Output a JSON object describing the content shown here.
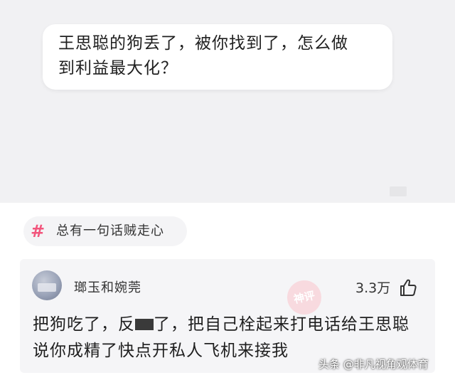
{
  "question": {
    "line1": "王思聪的狗丢了，被你找到了，怎么做",
    "line2": "到利益最大化？"
  },
  "topic": {
    "icon": "hash-icon",
    "hash_symbol": "#",
    "label": "总有一句话贼走心",
    "accent_color": "#f2557c"
  },
  "comment": {
    "username": "瑯玉和婉莞",
    "likes": "3.3万",
    "like_icon": "thumbs-up-icon",
    "stamp": "神评",
    "line1_part1": "把狗吃了，反",
    "line1_part2": "了，把自己栓起来打电话给王思聪",
    "line2": "说你成精了快点开私人飞机来接我"
  },
  "watermark": "头条 @非凡视角观体育"
}
